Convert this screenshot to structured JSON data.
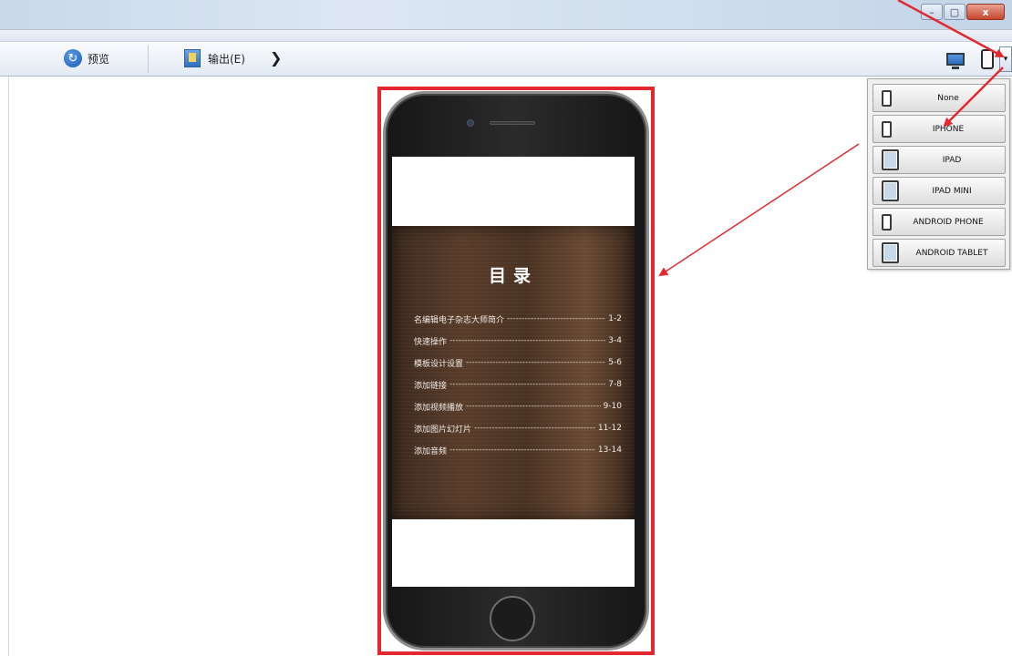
{
  "window": {
    "controls": {
      "minimize": "–",
      "maximize": "▢",
      "close": "x"
    }
  },
  "toolbar": {
    "preview_label": "预览",
    "output_label": "输出(E)",
    "more_glyph": "❯",
    "dropdown_glyph": "▾"
  },
  "preview": {
    "toc_title": "目录",
    "toc_items": [
      {
        "label": "名编辑电子杂志大师简介",
        "page": "1-2"
      },
      {
        "label": "快速操作",
        "page": "3-4"
      },
      {
        "label": "模板设计设置",
        "page": "5-6"
      },
      {
        "label": "添加链接",
        "page": "7-8"
      },
      {
        "label": "添加视频播放",
        "page": "9-10"
      },
      {
        "label": "添加图片幻灯片",
        "page": "11-12"
      },
      {
        "label": "添加音频",
        "page": "13-14"
      }
    ]
  },
  "device_menu": {
    "options": [
      {
        "label": "None",
        "icon": "phone-icon"
      },
      {
        "label": "IPHONE",
        "icon": "phone-icon"
      },
      {
        "label": "IPAD",
        "icon": "tablet-icon"
      },
      {
        "label": "IPAD MINI",
        "icon": "tablet-icon"
      },
      {
        "label": "ANDROID PHONE",
        "icon": "phone-icon"
      },
      {
        "label": "ANDROID TABLET",
        "icon": "tablet-icon"
      }
    ]
  },
  "colors": {
    "annotation_red": "#e5282f",
    "titlebar": "#c9d8ea"
  }
}
